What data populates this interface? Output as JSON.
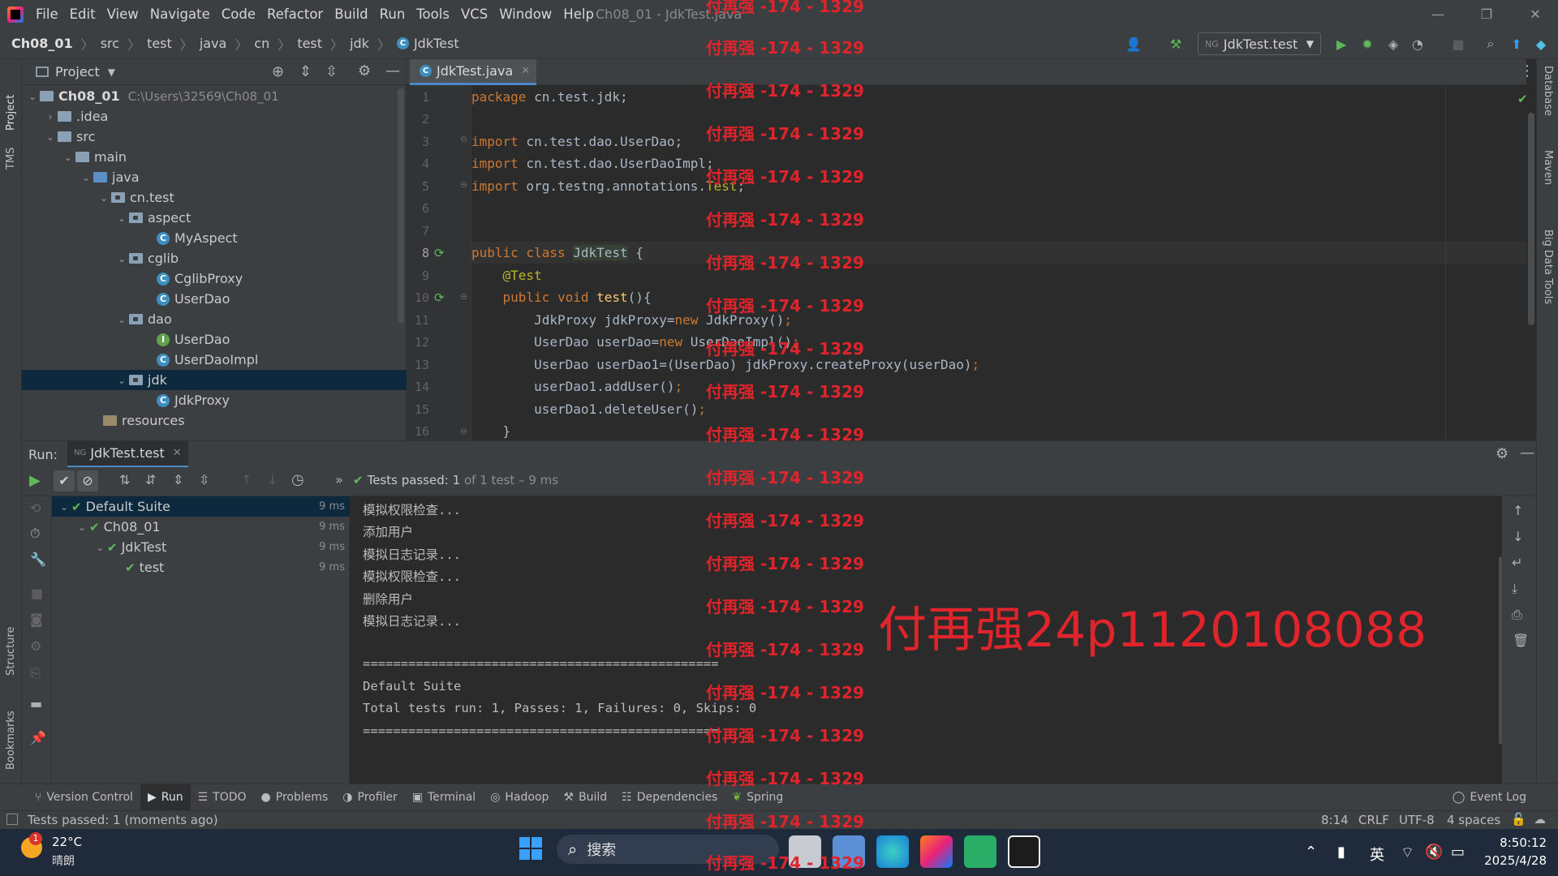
{
  "window": {
    "title": "Ch08_01 - JdkTest.java",
    "menu": [
      "File",
      "Edit",
      "View",
      "Navigate",
      "Code",
      "Refactor",
      "Build",
      "Run",
      "Tools",
      "VCS",
      "Window",
      "Help"
    ]
  },
  "breadcrumb": [
    "Ch08_01",
    "src",
    "test",
    "java",
    "cn",
    "test",
    "jdk",
    "JdkTest"
  ],
  "toolbar": {
    "run_config": "JdkTest.test"
  },
  "project_panel": {
    "title": "Project",
    "root_name": "Ch08_01",
    "root_path": "C:\\Users\\32569\\Ch08_01",
    "items": [
      {
        "label": ".idea"
      },
      {
        "label": "src"
      },
      {
        "label": "main"
      },
      {
        "label": "java"
      },
      {
        "label": "cn.test"
      },
      {
        "label": "aspect"
      },
      {
        "label": "MyAspect"
      },
      {
        "label": "cglib"
      },
      {
        "label": "CglibProxy"
      },
      {
        "label": "UserDao"
      },
      {
        "label": "dao"
      },
      {
        "label": "UserDao"
      },
      {
        "label": "UserDaoImpl"
      },
      {
        "label": "jdk"
      },
      {
        "label": "JdkProxy"
      },
      {
        "label": "resources"
      }
    ]
  },
  "editor": {
    "tab": "JdkTest.java",
    "line_numbers": [
      "1",
      "2",
      "3",
      "4",
      "5",
      "6",
      "7",
      "8",
      "9",
      "10",
      "11",
      "12",
      "13",
      "14",
      "15",
      "16"
    ],
    "lines": [
      "package cn.test.jdk;",
      "",
      "import cn.test.dao.UserDao;",
      "import cn.test.dao.UserDaoImpl;",
      "import org.testng.annotations.Test;",
      "",
      "",
      "public class JdkTest {",
      "    @Test",
      "    public void test(){",
      "        JdkProxy jdkProxy=new JdkProxy();",
      "        UserDao userDao=new UserDaoImpl();",
      "        UserDao userDao1=(UserDao) jdkProxy.createProxy(userDao);",
      "        userDao1.addUser();",
      "        userDao1.deleteUser();",
      "    }"
    ]
  },
  "run_panel": {
    "label": "Run:",
    "tab": "JdkTest.test",
    "status_prefix": "Tests passed:",
    "status_count": "1",
    "status_suffix": "of 1 test – 9 ms",
    "tree": [
      {
        "label": "Default Suite",
        "time": "9 ms"
      },
      {
        "label": "Ch08_01",
        "time": "9 ms"
      },
      {
        "label": "JdkTest",
        "time": "9 ms"
      },
      {
        "label": "test",
        "time": "9 ms"
      }
    ],
    "console": [
      "模拟权限检查...",
      "添加用户",
      "模拟日志记录...",
      "模拟权限检查...",
      "删除用户",
      "模拟日志记录...",
      "",
      "===============================================",
      "Default Suite",
      "Total tests run: 1, Passes: 1, Failures: 0, Skips: 0",
      "==============================================="
    ]
  },
  "bottom_tools": [
    "Version Control",
    "Run",
    "TODO",
    "Problems",
    "Profiler",
    "Terminal",
    "Hadoop",
    "Build",
    "Dependencies",
    "Spring"
  ],
  "event_log": "Event Log",
  "side_labels": {
    "left_top": [
      "Project",
      "TMS"
    ],
    "left_bottom": [
      "Structure",
      "Bookmarks"
    ],
    "right": [
      "Database",
      "Maven",
      "Big Data Tools"
    ]
  },
  "statusbar": {
    "message": "Tests passed: 1 (moments ago)",
    "position": "8:14",
    "line_sep": "CRLF",
    "encoding": "UTF-8",
    "indent": "4 spaces"
  },
  "taskbar": {
    "temperature": "22°C",
    "weather": "晴朗",
    "badge": "1",
    "search_placeholder": "搜索",
    "ime": "英",
    "time": "8:50:12",
    "date": "2025/4/28"
  },
  "watermark": {
    "repeat": "付再强 -174 - 1329",
    "big": "付再强24p1120108088"
  },
  "colors": {
    "accent": "#4a88c7",
    "pass": "#5fb85a",
    "watermark": "#e0242b"
  }
}
